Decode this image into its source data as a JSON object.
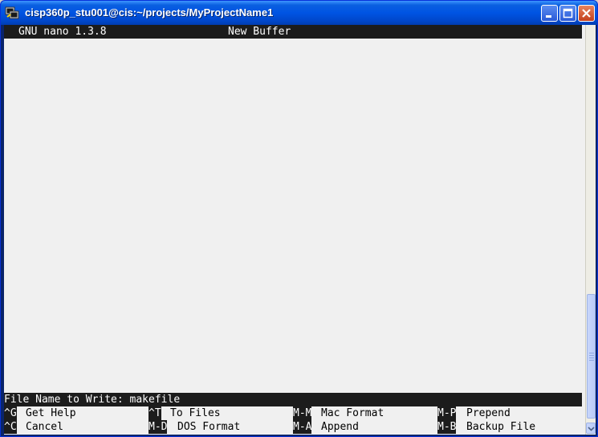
{
  "window": {
    "title": "cisp360p_stu001@cis:~/projects/MyProjectName1",
    "icon": "putty-terminal-icon",
    "buttons": [
      "minimize-icon",
      "maximize-icon",
      "close-icon"
    ],
    "accent": "#0054e3"
  },
  "nano": {
    "version_label": "GNU nano 1.3.8",
    "buffer_label": "New Buffer",
    "prompt_text": "File Name to Write: makefile",
    "shortcuts_row1": [
      {
        "key": "^G",
        "label": "Get Help"
      },
      {
        "key": "^T",
        "label": "To Files"
      },
      {
        "key": "M-M",
        "label": "Mac Format"
      },
      {
        "key": "M-P",
        "label": "Prepend"
      }
    ],
    "shortcuts_row2": [
      {
        "key": "^C",
        "label": "Cancel"
      },
      {
        "key": "M-D",
        "label": "DOS Format"
      },
      {
        "key": "M-A",
        "label": "Append"
      },
      {
        "key": "M-B",
        "label": "Backup File"
      }
    ]
  },
  "colors": {
    "terminal_bg": "#f4f4f4",
    "bar_bg": "#1c1c1c",
    "bar_fg": "#ffffff"
  }
}
